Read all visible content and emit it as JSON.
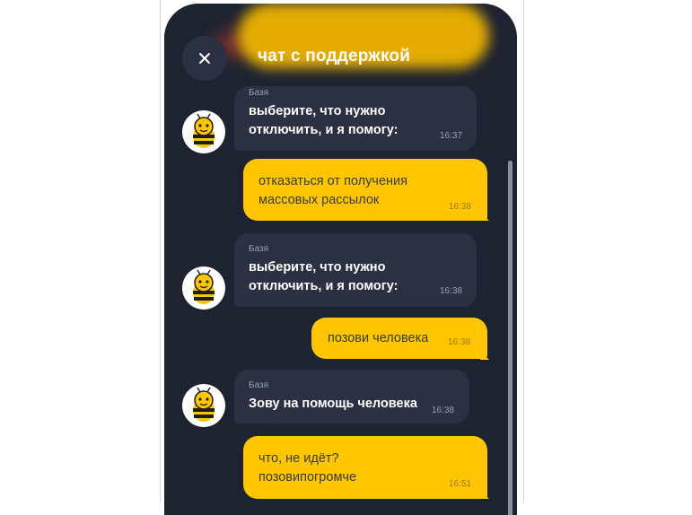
{
  "header": {
    "title": "чат с поддержкой",
    "close_icon": "close-icon"
  },
  "messages": [
    {
      "direction": "incoming",
      "sender": "Базя",
      "text_lines": [
        "выберите, что нужно",
        "отключить, и я помогу:"
      ],
      "time": "16:37"
    },
    {
      "direction": "outgoing",
      "text_lines": [
        "отказаться от получения",
        "массовых рассылок"
      ],
      "time": "16:38"
    },
    {
      "direction": "incoming",
      "sender": "Базя",
      "text_lines": [
        "выберите, что нужно",
        "отключить, и я помогу:"
      ],
      "time": "16:38"
    },
    {
      "direction": "outgoing",
      "text_lines": [
        "позови человека"
      ],
      "time": "16:38"
    },
    {
      "direction": "incoming",
      "sender": "Базя",
      "text_lines": [
        "Зову на помощь человека"
      ],
      "time": "16:38"
    },
    {
      "direction": "outgoing",
      "text_lines": [
        "что, не идёт?",
        "позовипогромче"
      ],
      "time": "16:51"
    }
  ],
  "avatar_icon": "bee-icon",
  "colors": {
    "background": "#1e2331",
    "incoming_bubble": "#2b3142",
    "outgoing_bubble": "#ffc600",
    "accent": "#ffc600"
  }
}
